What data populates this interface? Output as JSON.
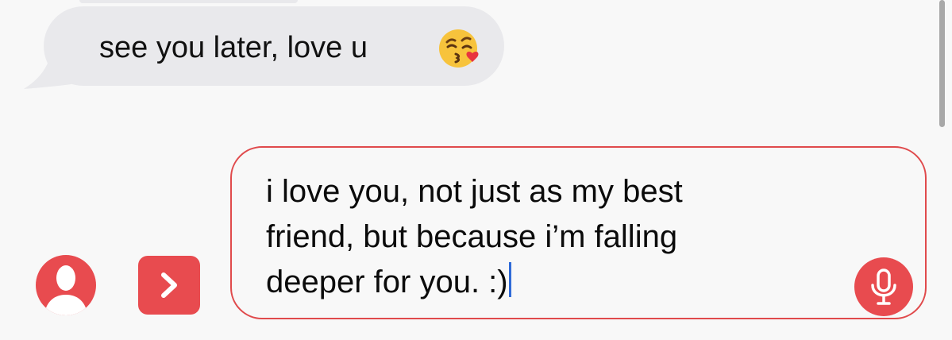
{
  "conversation": {
    "received_message": {
      "text": "see you later, love u",
      "emoji": "face-blowing-a-kiss-icon"
    }
  },
  "composer": {
    "lines": [
      "i love you, not just as my best",
      "friend, but because i’m falling",
      "deeper for you. :)"
    ]
  },
  "colors": {
    "accent": "#e84b4f",
    "received_bubble": "#e9e9ec",
    "background": "#f8f8f8",
    "caret": "#2f6bd8"
  },
  "icons": {
    "contact": "person-silhouette-icon",
    "apps": "chevron-right-icon",
    "mic": "microphone-icon"
  }
}
